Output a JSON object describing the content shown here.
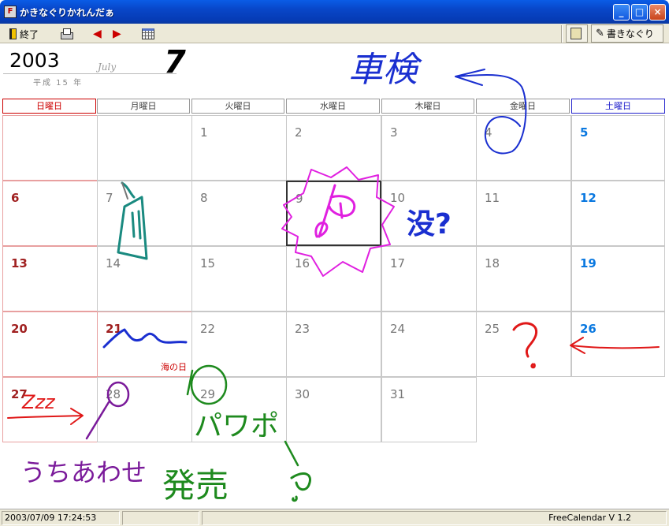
{
  "window": {
    "title": "かきなぐりかれんだぁ",
    "app_icon_text": "F"
  },
  "window_buttons": {
    "minimize": "_",
    "maximize": "□",
    "close": "×"
  },
  "toolbar": {
    "exit_label": "終了",
    "print_icon": "printer-icon",
    "prev_icon": "arrow-left-icon",
    "next_icon": "arrow-right-icon",
    "calendar_icon": "calendar-icon",
    "doodle_label": "書きなぐり"
  },
  "header": {
    "year": "2003",
    "month_name": "July",
    "month_number": "7",
    "era": "平成 15 年"
  },
  "weekdays": [
    "日曜日",
    "月曜日",
    "火曜日",
    "水曜日",
    "木曜日",
    "金曜日",
    "土曜日"
  ],
  "days": [
    {
      "n": "",
      "kind": "sun"
    },
    {
      "n": "",
      "kind": ""
    },
    {
      "n": "1",
      "kind": ""
    },
    {
      "n": "2",
      "kind": ""
    },
    {
      "n": "3",
      "kind": ""
    },
    {
      "n": "4",
      "kind": ""
    },
    {
      "n": "5",
      "kind": "sat"
    },
    {
      "n": "6",
      "kind": "sun"
    },
    {
      "n": "7",
      "kind": ""
    },
    {
      "n": "8",
      "kind": ""
    },
    {
      "n": "9",
      "kind": "today"
    },
    {
      "n": "10",
      "kind": ""
    },
    {
      "n": "11",
      "kind": ""
    },
    {
      "n": "12",
      "kind": "sat"
    },
    {
      "n": "13",
      "kind": "sun"
    },
    {
      "n": "14",
      "kind": ""
    },
    {
      "n": "15",
      "kind": ""
    },
    {
      "n": "16",
      "kind": ""
    },
    {
      "n": "17",
      "kind": ""
    },
    {
      "n": "18",
      "kind": ""
    },
    {
      "n": "19",
      "kind": "sat"
    },
    {
      "n": "20",
      "kind": "sun"
    },
    {
      "n": "21",
      "kind": "hol",
      "holiday": "海の日"
    },
    {
      "n": "22",
      "kind": ""
    },
    {
      "n": "23",
      "kind": ""
    },
    {
      "n": "24",
      "kind": ""
    },
    {
      "n": "25",
      "kind": ""
    },
    {
      "n": "26",
      "kind": "sat"
    },
    {
      "n": "27",
      "kind": "sun"
    },
    {
      "n": "28",
      "kind": ""
    },
    {
      "n": "29",
      "kind": ""
    },
    {
      "n": "30",
      "kind": ""
    },
    {
      "n": "31",
      "kind": ""
    }
  ],
  "handwriting": {
    "top": "車検",
    "day10": "没?",
    "day27": "Zzz",
    "bottom_left": "うちあわせ",
    "day29": "パワポ",
    "bottom_mid": "発売"
  },
  "colors": {
    "sunday": "#a02020",
    "saturday": "#0a78e0",
    "blue_ink": "#1a2fd0",
    "magenta_ink": "#e020e0",
    "teal_ink": "#1a8a80",
    "red_ink": "#e01818",
    "green_ink": "#1e8a1e",
    "purple_ink": "#7a1a9a"
  },
  "status": {
    "datetime": "2003/07/09 17:24:53",
    "app_version": "FreeCalendar  V 1.2"
  }
}
